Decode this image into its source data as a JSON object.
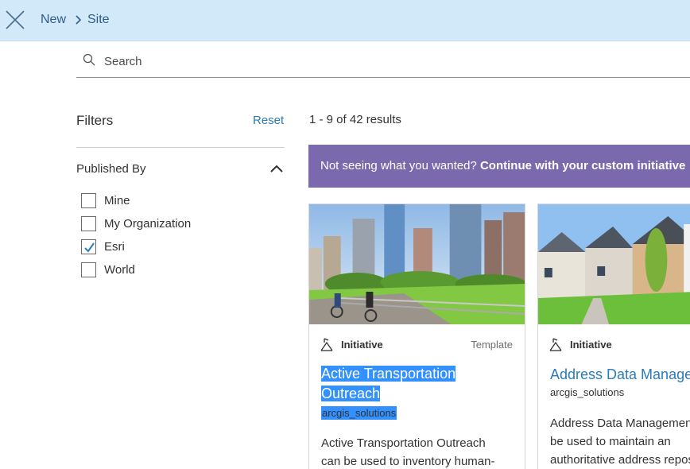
{
  "header": {
    "breadcrumb": [
      "New",
      "Site"
    ]
  },
  "search": {
    "placeholder": "Search",
    "value": ""
  },
  "filters": {
    "title": "Filters",
    "reset_label": "Reset",
    "group": {
      "title": "Published By",
      "options": [
        {
          "label": "Mine",
          "checked": false
        },
        {
          "label": "My Organization",
          "checked": false
        },
        {
          "label": "Esri",
          "checked": true
        },
        {
          "label": "World",
          "checked": false
        }
      ]
    }
  },
  "results": {
    "count_text": "1 - 9 of 42 results"
  },
  "banner": {
    "prefix": "Not seeing what you wanted? ",
    "strong": "Continue with your custom initiative"
  },
  "cards": [
    {
      "type": "Initiative",
      "badge": "Template",
      "title_line1": "Active Transportation",
      "title_line2": "Outreach",
      "owner": "arcgis_solutions",
      "desc_line1": "Active Transportation Outreach",
      "desc_line2": "can be used to inventory human-"
    },
    {
      "type": "Initiative",
      "title": "Address Data Management",
      "owner": "arcgis_solutions",
      "desc_line1": "Address Data Management can",
      "desc_line2": "be used to maintain an",
      "desc_line3": "authoritative address repository"
    }
  ],
  "colors": {
    "topbar": "#d2e9f9",
    "accent_link": "#2b7bb9",
    "banner": "#7a69ad",
    "selection": "#3390ff"
  }
}
